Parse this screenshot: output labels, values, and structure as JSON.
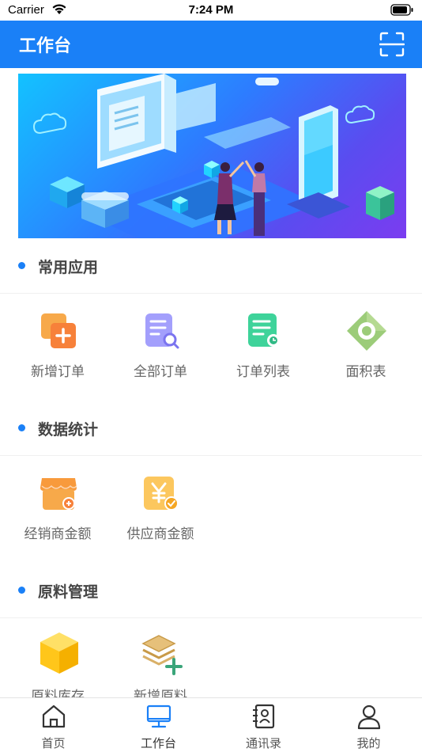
{
  "status_bar": {
    "carrier": "Carrier",
    "time": "7:24 PM"
  },
  "nav": {
    "title": "工作台"
  },
  "sections": {
    "common": {
      "title": "常用应用",
      "items": [
        {
          "label": "新增订单",
          "icon": "add-order-icon"
        },
        {
          "label": "全部订单",
          "icon": "search-document-icon"
        },
        {
          "label": "订单列表",
          "icon": "order-list-icon"
        },
        {
          "label": "面积表",
          "icon": "area-table-icon"
        }
      ]
    },
    "stats": {
      "title": "数据统计",
      "items": [
        {
          "label": "经销商金额",
          "icon": "dealer-shop-icon"
        },
        {
          "label": "供应商金额",
          "icon": "yen-check-icon"
        }
      ]
    },
    "materials": {
      "title": "原料管理",
      "items": [
        {
          "label": "原料库存",
          "icon": "yellow-box-icon"
        },
        {
          "label": "新增原料",
          "icon": "layers-plus-icon"
        }
      ]
    }
  },
  "tabs": [
    {
      "label": "首页",
      "icon": "home-icon"
    },
    {
      "label": "工作台",
      "icon": "monitor-icon",
      "active": true
    },
    {
      "label": "通讯录",
      "icon": "contacts-icon"
    },
    {
      "label": "我的",
      "icon": "user-icon"
    }
  ],
  "colors": {
    "primary": "#1A80F7"
  }
}
